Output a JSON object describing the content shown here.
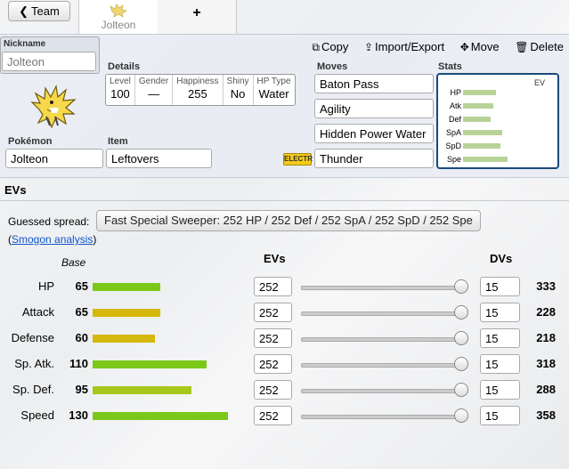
{
  "topbar": {
    "team_label": "Team",
    "tab_label": "Jolteon",
    "add_tab_label": "+"
  },
  "set": {
    "nickname_label": "Nickname",
    "nickname_value": "Jolteon",
    "actions": {
      "copy": "Copy",
      "import_export": "Import/Export",
      "move": "Move",
      "delete": "Delete"
    },
    "details_label": "Details",
    "details": [
      {
        "header": "Level",
        "value": "100"
      },
      {
        "header": "Gender",
        "value": "—"
      },
      {
        "header": "Happiness",
        "value": "255"
      },
      {
        "header": "Shiny",
        "value": "No"
      },
      {
        "header": "HP Type",
        "value": "Water"
      }
    ],
    "type_badge": "ELECTR",
    "pokemon_label": "Pokémon",
    "pokemon_value": "Jolteon",
    "item_label": "Item",
    "item_value": "Leftovers",
    "moves_label": "Moves",
    "moves": [
      "Baton Pass",
      "Agility",
      "Hidden Power Water",
      "Thunder"
    ],
    "stats_label": "Stats",
    "stats_ev_header": "EV",
    "stats_mini": [
      {
        "name": "HP",
        "level": 0.62
      },
      {
        "name": "Atk",
        "level": 0.56
      },
      {
        "name": "Def",
        "level": 0.52
      },
      {
        "name": "SpA",
        "level": 0.74
      },
      {
        "name": "SpD",
        "level": 0.7
      },
      {
        "name": "Spe",
        "level": 0.84
      }
    ]
  },
  "evs": {
    "section_title": "EVs",
    "guessed_label": "Guessed spread:",
    "guessed_value": "Fast Special Sweeper: 252 HP / 252 Def / 252 SpA / 252 SpD / 252 Spe",
    "smogon_open": "(",
    "smogon_link": "Smogon analysis",
    "smogon_close": ")",
    "col_base": "Base",
    "col_evs": "EVs",
    "col_dvs": "DVs",
    "rows": [
      {
        "name": "HP",
        "base": "65",
        "ev": "252",
        "dv": "15",
        "total": "333",
        "color": "#7bc81a"
      },
      {
        "name": "Attack",
        "base": "65",
        "ev": "252",
        "dv": "15",
        "total": "228",
        "color": "#d4b80c"
      },
      {
        "name": "Defense",
        "base": "60",
        "ev": "252",
        "dv": "15",
        "total": "218",
        "color": "#d4b80c"
      },
      {
        "name": "Sp. Atk.",
        "base": "110",
        "ev": "252",
        "dv": "15",
        "total": "318",
        "color": "#7bc81a"
      },
      {
        "name": "Sp. Def.",
        "base": "95",
        "ev": "252",
        "dv": "15",
        "total": "288",
        "color": "#a6c81a"
      },
      {
        "name": "Speed",
        "base": "130",
        "ev": "252",
        "dv": "15",
        "total": "358",
        "color": "#7bc81a"
      }
    ]
  }
}
